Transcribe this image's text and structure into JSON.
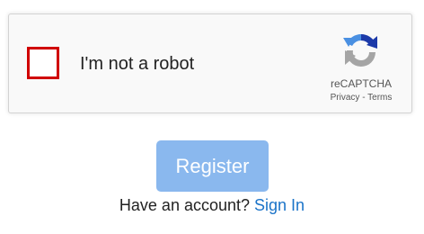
{
  "captcha": {
    "checkbox_label": "I'm not a robot",
    "checked": false,
    "brand_name": "reCAPTCHA",
    "privacy_link": "Privacy",
    "links_separator": "-",
    "terms_link": "Terms",
    "logo_icon": "recaptcha-logo-icon",
    "checkbox_border_color": "#d00000"
  },
  "form": {
    "register_label": "Register",
    "register_color": "#8ab8ee",
    "account_prompt": "Have an account?",
    "signin_label": "Sign In",
    "link_color": "#1a73c8"
  }
}
